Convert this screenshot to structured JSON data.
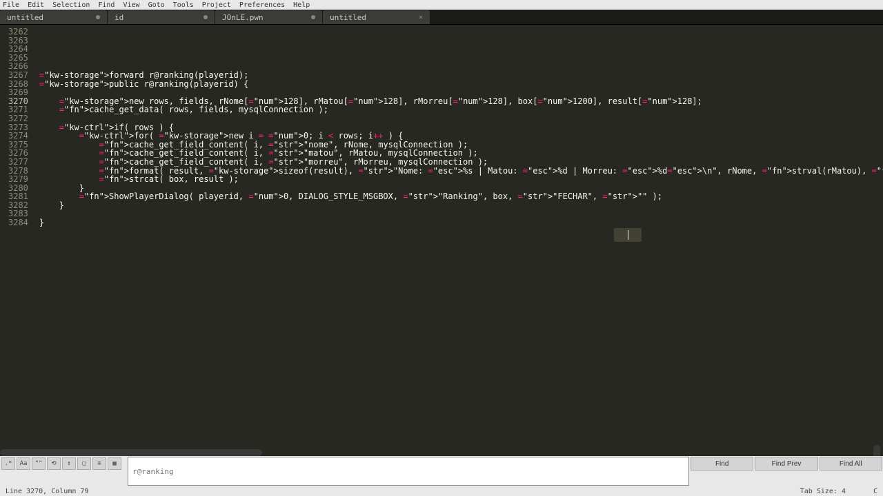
{
  "menu": {
    "items": [
      "File",
      "Edit",
      "Selection",
      "Find",
      "View",
      "Goto",
      "Tools",
      "Project",
      "Preferences",
      "Help"
    ]
  },
  "tabs": [
    {
      "label": "untitled",
      "modified": true,
      "closable": false
    },
    {
      "label": "id",
      "modified": true,
      "closable": false
    },
    {
      "label": "JOnLE.pwn",
      "modified": true,
      "closable": false
    },
    {
      "label": "untitled",
      "modified": false,
      "closable": true
    }
  ],
  "gutter": {
    "start": 3262,
    "end": 3284,
    "highlighted": 3270
  },
  "code": {
    "lines": [
      "",
      "",
      "",
      "",
      "",
      "forward r@ranking(playerid);",
      "public r@ranking(playerid) {",
      "",
      "    new rows, fields, rNome[128], rMatou[128], rMorreu[128], box[1200], result[128];",
      "    cache_get_data( rows, fields, mysqlConnection );",
      "",
      "    if( rows ) {",
      "        for( new i = 0; i < rows; i++ ) {",
      "            cache_get_field_content( i, \"nome\", rNome, mysqlConnection );",
      "            cache_get_field_content( i, \"matou\", rMatou, mysqlConnection );",
      "            cache_get_field_content( i, \"morreu\", rMorreu, mysqlConnection );",
      "            format( result, sizeof(result), \"Nome: %s | Matou: %d | Morreu: %d\\n\", rNome, strval(rMatou), strval(rMorreu) );",
      "            strcat( box, result );",
      "        }",
      "        ShowPlayerDialog( playerid, 0, DIALOG_STYLE_MSGBOX, \"Ranking\", box, \"FECHAR\", \"\" );",
      "    }",
      "",
      "}"
    ]
  },
  "find": {
    "input_placeholder": "r@ranking",
    "buttons": {
      "find": "Find",
      "find_prev": "Find Prev",
      "find_all": "Find All"
    },
    "toggle_icons": [
      ".*",
      "Aa",
      "\"\"",
      "⟲",
      "↕",
      "▢",
      "≡",
      "▦"
    ]
  },
  "status": {
    "left": "Line 3270, Column 79",
    "tabsize": "Tab Size: 4",
    "lang": "C"
  }
}
